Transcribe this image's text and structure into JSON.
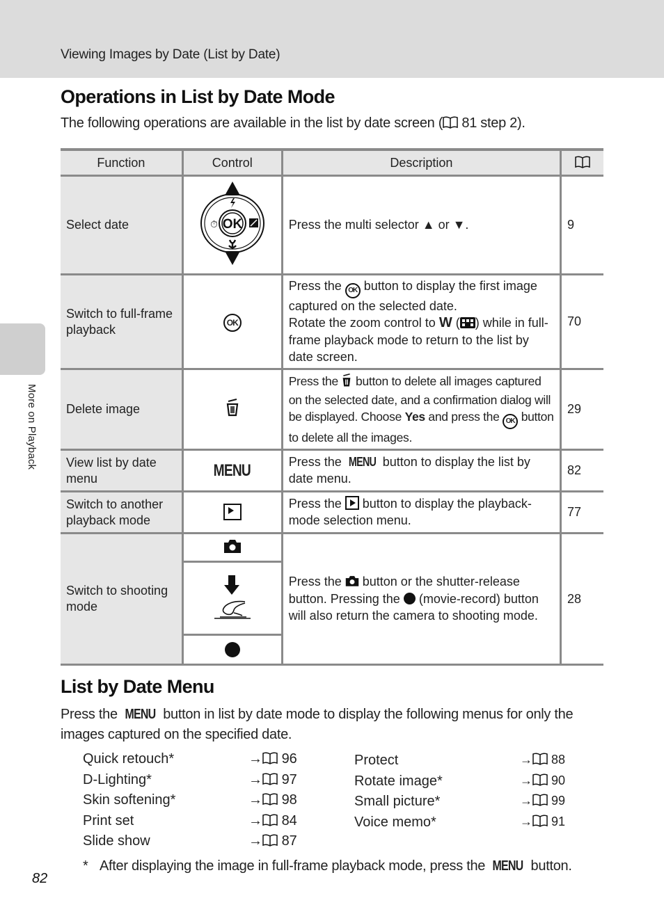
{
  "header": {
    "breadcrumb": "Viewing Images by Date (List by Date)"
  },
  "side_tab": {
    "label": "More on Playback"
  },
  "section1": {
    "title": "Operations in List by Date Mode",
    "intro_before": "The following operations are available in the list by date screen (",
    "intro_ref": "81 step 2",
    "intro_after": ")."
  },
  "table": {
    "headers": {
      "function": "Function",
      "control": "Control",
      "description": "Description",
      "page_icon": "book-icon"
    },
    "rows": [
      {
        "function": "Select date",
        "control_icon": "multi-selector-up-down-icon",
        "description": "Press the multi selector ▲ or ▼.",
        "page": "9"
      },
      {
        "function": "Switch to full-frame playback",
        "control_icon": "ok-button-icon",
        "description_p1_a": "Press the",
        "description_p1_b": "button to display the first image captured on the selected date.",
        "description_p2_a": "Rotate the zoom control to",
        "description_p2_w": "W",
        "description_p2_b": ") while in full-frame playback mode to return to the list by date screen.",
        "page": "70"
      },
      {
        "function": "Delete image",
        "control_icon": "delete-trash-icon",
        "description_a": "Press the",
        "description_b": "button to delete all images captured on the selected date, and a confirmation dialog will be displayed. Choose",
        "description_yes": "Yes",
        "description_c": "and press the",
        "description_d": "button to delete all the images.",
        "page": "29"
      },
      {
        "function": "View list by date menu",
        "control_label": "MENU",
        "description_a": "Press the",
        "description_menu": "MENU",
        "description_b": "button to display the list by date menu.",
        "page": "82"
      },
      {
        "function": "Switch to another playback mode",
        "control_icon": "playback-button-icon",
        "description_a": "Press the",
        "description_b": "button to display the playback-mode selection menu.",
        "page": "77"
      },
      {
        "function": "Switch to shooting mode",
        "control_icons": [
          "shooting-camera-icon",
          "shutter-release-press-icon",
          "movie-record-icon"
        ],
        "description_a": "Press the",
        "description_b": "button or the shutter-release button. Pressing the",
        "description_c": "(movie-record) button will also return the camera to shooting mode.",
        "page": "28"
      }
    ]
  },
  "section2": {
    "title": "List by Date Menu",
    "intro_a": "Press the",
    "intro_menu": "MENU",
    "intro_b": "button in list by date mode to display the following menus for only the images captured on the specified date.",
    "left_items": [
      {
        "label": "Quick retouch*",
        "page": "96"
      },
      {
        "label": "D-Lighting*",
        "page": "97"
      },
      {
        "label": "Skin softening*",
        "page": "98"
      },
      {
        "label": "Print set",
        "page": "84"
      },
      {
        "label": "Slide show",
        "page": "87"
      }
    ],
    "right_items": [
      {
        "label": "Protect",
        "page": "88"
      },
      {
        "label": "Rotate image*",
        "page": "90"
      },
      {
        "label": "Small picture*",
        "page": "99"
      },
      {
        "label": "Voice memo*",
        "page": "91"
      }
    ],
    "arrow": "→",
    "footnote_star": "*",
    "footnote_a": "After displaying the image in full-frame playback mode, press the",
    "footnote_menu": "MENU",
    "footnote_b": "button."
  },
  "page_number": "82"
}
